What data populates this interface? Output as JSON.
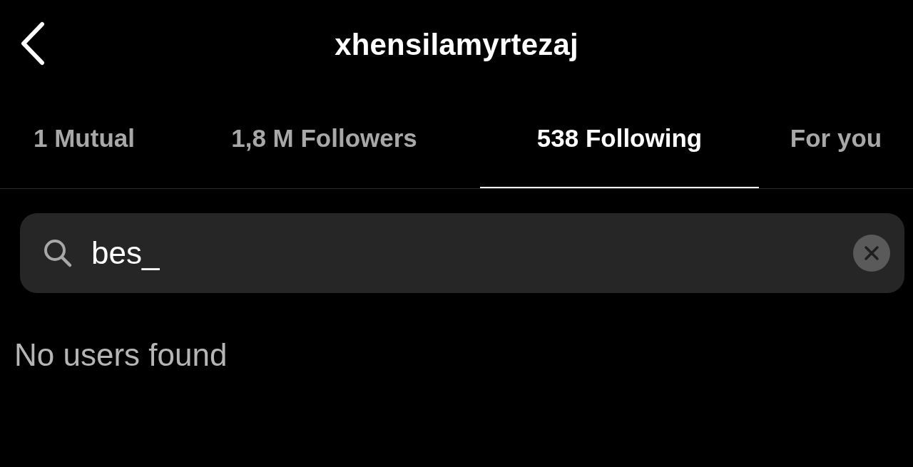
{
  "header": {
    "title": "xhensilamyrtezaj"
  },
  "tabs": [
    {
      "label": "1 Mutual",
      "selected": false
    },
    {
      "label": "1,8 M Followers",
      "selected": false
    },
    {
      "label": "538 Following",
      "selected": true
    },
    {
      "label": "For you",
      "selected": false
    }
  ],
  "search": {
    "value": "bes_"
  },
  "empty_message": "No users found"
}
